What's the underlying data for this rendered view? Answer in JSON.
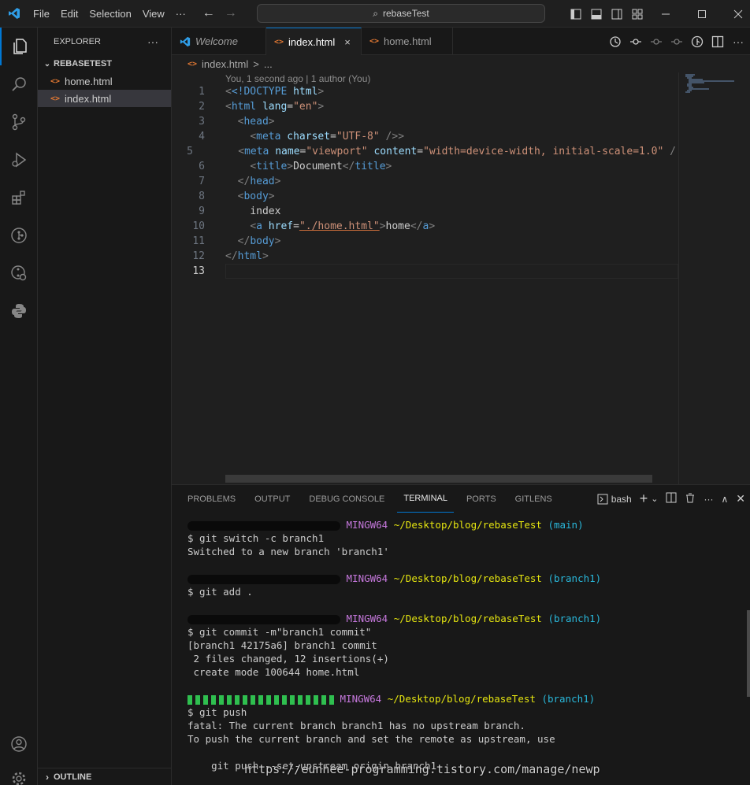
{
  "titlebar": {
    "menu": [
      "File",
      "Edit",
      "Selection",
      "View",
      "···"
    ],
    "search": "rebaseTest"
  },
  "explorer": {
    "header": "EXPLORER",
    "more": "···",
    "folder": "REBASETEST",
    "files": [
      "home.html",
      "index.html"
    ],
    "outline": "OUTLINE"
  },
  "editor": {
    "tabs": [
      {
        "label": "Welcome"
      },
      {
        "label": "index.html",
        "close": "×"
      },
      {
        "label": "home.html"
      }
    ],
    "breadcrumb": {
      "file": "index.html",
      "sep": ">",
      "rest": "..."
    },
    "blame": "You, 1 second ago | 1 author (You)",
    "line_numbers": [
      "1",
      "2",
      "3",
      "4",
      "5",
      "6",
      "7",
      "8",
      "9",
      "10",
      "11",
      "12",
      "13"
    ],
    "code": {
      "l1_a": "<!DOCTYPE",
      "l1_b": " html",
      "l1_c": ">",
      "l2_tag": "html",
      "l2_attr": " lang",
      "l2_val": "\"en\"",
      "l3": "head",
      "l4_tag": "meta",
      "l4_attr": " charset",
      "l4_val": "\"UTF-8\"",
      "l4_end": " />",
      "l5_tag": "meta",
      "l5_attr1": " name",
      "l5_val1": "\"viewport\"",
      "l5_attr2": " content",
      "l5_val2": "\"width=device-width, initial-scale=1.0\"",
      "l5_end": " /",
      "l6_tag": "title",
      "l6_text": "Document",
      "l7": "head",
      "l8": "body",
      "l9": "index",
      "l10_tag": "a",
      "l10_attr": " href",
      "l10_val": "\"./home.html\"",
      "l10_text": "home",
      "l11": "body",
      "l12": "html"
    }
  },
  "panel": {
    "tabs": [
      "PROBLEMS",
      "OUTPUT",
      "DEBUG CONSOLE",
      "TERMINAL",
      "PORTS",
      "GITLENS"
    ],
    "shell": "bash",
    "terminal": {
      "host": "MINGW64",
      "path": "~/Desktop/blog/rebaseTest",
      "branch_main": "(main)",
      "branch1": "(branch1)",
      "cmd1": "$ git switch -c branch1",
      "out1": "Switched to a new branch 'branch1'",
      "cmd2": "$ git add .",
      "cmd3": "$ git commit -m\"branch1 commit\"",
      "out3a": "[branch1 42175a6] branch1 commit",
      "out3b": " 2 files changed, 12 insertions(+)",
      "out3c": " create mode 100644 home.html",
      "cmd4": "$ git push",
      "out4a": "fatal: The current branch branch1 has no upstream branch.",
      "out4b": "To push the current branch and set the remote as upstream, use",
      "out4c": "    git push --set-upstream origin branch1"
    }
  },
  "watermark": "https://eunhee-programming.tistory.com/manage/newp",
  "colors": {
    "accent": "#0078d4",
    "html_icon": "#e37933"
  }
}
